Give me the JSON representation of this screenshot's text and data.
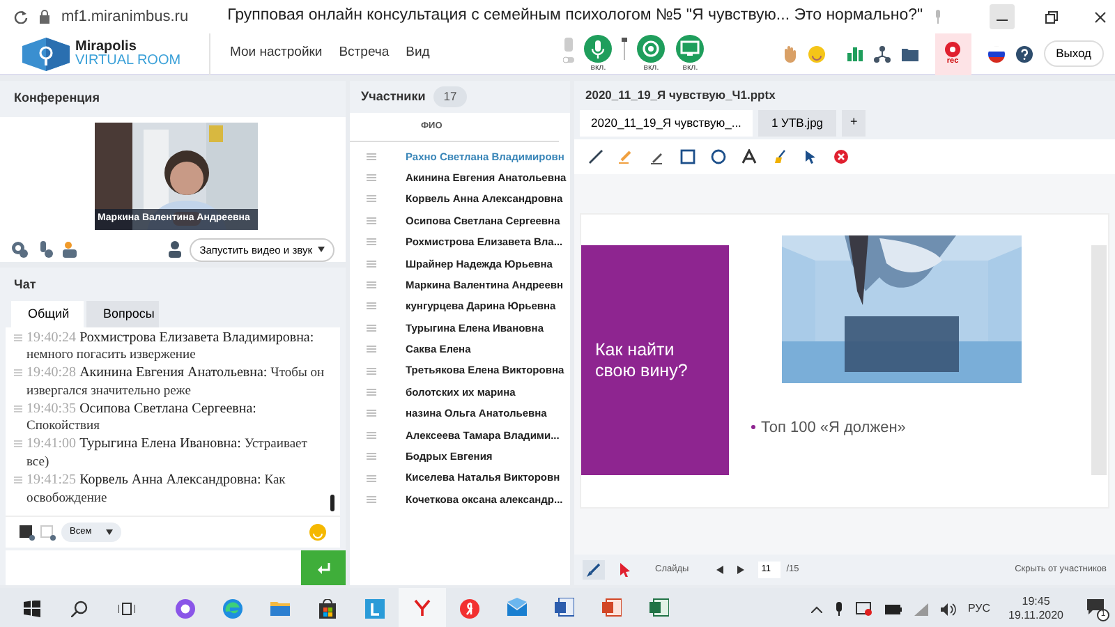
{
  "browser": {
    "url": "mf1.miranimbus.ru",
    "title": "Групповая онлайн консультация с семейным психологом №5 \"Я чувствую... Это нормально?\""
  },
  "app": {
    "logo_line1": "Mirapolis",
    "logo_line2": "VIRTUAL ROOM",
    "menu": [
      "Мои настройки",
      "Встреча",
      "Вид"
    ],
    "media": [
      {
        "kind": "mic",
        "label": "вкл.",
        "on": true
      },
      {
        "kind": "camera",
        "label": "вкл.",
        "on": true
      },
      {
        "kind": "screen",
        "label": "вкл.",
        "on": true
      }
    ],
    "rec": "rec",
    "exit": "Выход"
  },
  "conference": {
    "title": "Конференция",
    "video_name": "Маркина Валентина  Андреевна",
    "start_button": "Запустить видео и звук"
  },
  "chat": {
    "title": "Чат",
    "tabs": [
      {
        "label": "Общий",
        "selected": true
      },
      {
        "label": "Вопросы",
        "selected": false
      }
    ],
    "messages": [
      {
        "time": "19:40:24",
        "author": "Рохмистрова  Елизавета Владимировна:",
        "text": "немного погасить извержение"
      },
      {
        "time": "19:40:28",
        "author": "Акинина  Евгения Анатольевна:",
        "text": "Чтобы он извергался значительно реже"
      },
      {
        "time": "19:40:35",
        "author": "Осипова  Светлана Сергеевна:",
        "text": "Спокойствия"
      },
      {
        "time": "19:41:00",
        "author": "Турыгина  Елена  Ивановна:",
        "text": "Устраивает все)"
      },
      {
        "time": "19:41:25",
        "author": "Корвель Анна  Александровна:",
        "text": "Как освобождение"
      }
    ],
    "audience": "Всем"
  },
  "participants": {
    "title": "Участники",
    "count": "17",
    "column": "ФИО",
    "rows": [
      {
        "name": "Рахно Светлана  Владимировн",
        "selected": true
      },
      {
        "name": "Акинина  Евгения Анатольевна",
        "selected": false
      },
      {
        "name": "Корвель Анна  Александровна",
        "selected": false
      },
      {
        "name": "Осипова  Светлана Сергеевна",
        "selected": false
      },
      {
        "name": "Рохмистрова  Елизавета Вла...",
        "selected": false
      },
      {
        "name": "Шрайнер Надежда  Юрьевна",
        "selected": false
      },
      {
        "name": "Маркина Валентина  Андреевн",
        "selected": false
      },
      {
        "name": "кунгурцева  Дарина  Юрьевна",
        "selected": false
      },
      {
        "name": "Турыгина  Елена  Ивановна",
        "selected": false
      },
      {
        "name": "Саква  Елена",
        "selected": false
      },
      {
        "name": "Третьякова  Елена Викторовна",
        "selected": false
      },
      {
        "name": "болотских их марина",
        "selected": false
      },
      {
        "name": "назина  Ольга Анатольевна",
        "selected": false
      },
      {
        "name": "Алексеева  Тамара  Владими...",
        "selected": false
      },
      {
        "name": "Бодрых  Евгения",
        "selected": false
      },
      {
        "name": "Киселева  Наталья  Викторовн",
        "selected": false
      },
      {
        "name": "Кочеткова  оксана александр...",
        "selected": false
      }
    ]
  },
  "presentation": {
    "file_title": "2020_11_19_Я чувствую_Ч1.pptx",
    "tabs": [
      {
        "label": "2020_11_19_Я чувствую_...",
        "selected": true
      },
      {
        "label": "1 УТВ.jpg",
        "selected": false
      }
    ],
    "add": "+",
    "slide": {
      "heading": "Как найти свою вину?",
      "bullet": "Топ 100 «Я должен»"
    },
    "footer": {
      "slides_label": "Слайды",
      "page": "11",
      "total": "/15",
      "hide": "Скрыть от участников"
    }
  },
  "taskbar": {
    "lang": "РУС",
    "time": "19:45",
    "date": "19.11.2020",
    "notifications": "1"
  }
}
